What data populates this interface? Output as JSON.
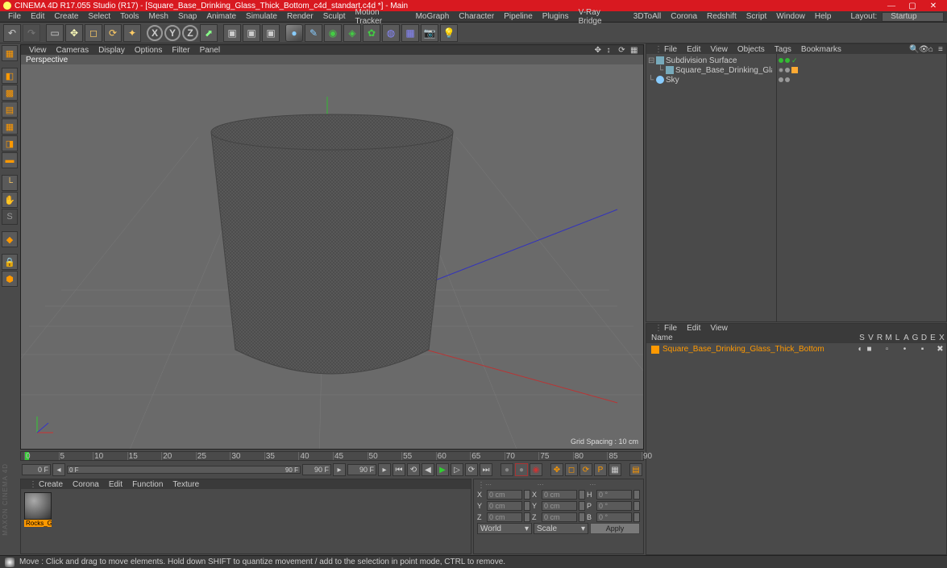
{
  "title": "CINEMA 4D R17.055 Studio (R17) - [Square_Base_Drinking_Glass_Thick_Bottom_c4d_standart.c4d *] - Main",
  "window_buttons": {
    "min": "—",
    "max": "▢",
    "close": "✕"
  },
  "menubar": [
    "File",
    "Edit",
    "Create",
    "Select",
    "Tools",
    "Mesh",
    "Snap",
    "Animate",
    "Simulate",
    "Render",
    "Sculpt",
    "Motion Tracker",
    "MoGraph",
    "Character",
    "Pipeline",
    "Plugins",
    "V-Ray Bridge",
    "3DToAll",
    "Corona",
    "Redshift",
    "Script",
    "Window",
    "Help"
  ],
  "layout_label": "Layout:",
  "layout_value": "Startup",
  "viewport": {
    "menu": [
      "View",
      "Cameras",
      "Display",
      "Options",
      "Filter",
      "Panel"
    ],
    "camera": "Perspective",
    "grid_info": "Grid Spacing : 10 cm"
  },
  "timeline": {
    "start": 0,
    "end": 90,
    "tick": 5,
    "slider_left": "0 F",
    "slider_right": "90 F",
    "field_left": "0 F",
    "field_right": "0 F"
  },
  "material_panel": {
    "menu": [
      "Create",
      "Corona",
      "Edit",
      "Function",
      "Texture"
    ],
    "material_name": "Rocks_G"
  },
  "coord_panel": {
    "rows": [
      {
        "axis": "X",
        "pos": "0 cm",
        "size_axis": "X",
        "size": "0 cm",
        "rot_axis": "H",
        "rot": "0 °"
      },
      {
        "axis": "Y",
        "pos": "0 cm",
        "size_axis": "Y",
        "size": "0 cm",
        "rot_axis": "P",
        "rot": "0 °"
      },
      {
        "axis": "Z",
        "pos": "0 cm",
        "size_axis": "Z",
        "size": "0 cm",
        "rot_axis": "B",
        "rot": "0 °"
      }
    ],
    "mode1": "World",
    "mode2": "Scale",
    "apply": "Apply"
  },
  "obj_panel": {
    "menu": [
      "File",
      "Edit",
      "View",
      "Objects",
      "Tags",
      "Bookmarks"
    ],
    "items": [
      {
        "name": "Subdivision Surface",
        "icon": "#7ab",
        "child": null
      },
      {
        "name": "Square_Base_Drinking_Glass_Thick_Bottom",
        "icon": "#7ab",
        "indent": 1
      },
      {
        "name": "Sky",
        "icon": "#8cf",
        "indent": 0
      }
    ]
  },
  "take_panel": {
    "menu": [
      "File",
      "Edit",
      "View"
    ],
    "header": "Name",
    "cols": [
      "S",
      "V",
      "R",
      "M",
      "L",
      "A",
      "G",
      "D",
      "E",
      "X"
    ],
    "item": "Square_Base_Drinking_Glass_Thick_Bottom"
  },
  "status": "Move : Click and drag to move elements. Hold down SHIFT to quantize movement / add to the selection in point mode, CTRL to remove.",
  "brand": "MAXON CINEMA 4D"
}
